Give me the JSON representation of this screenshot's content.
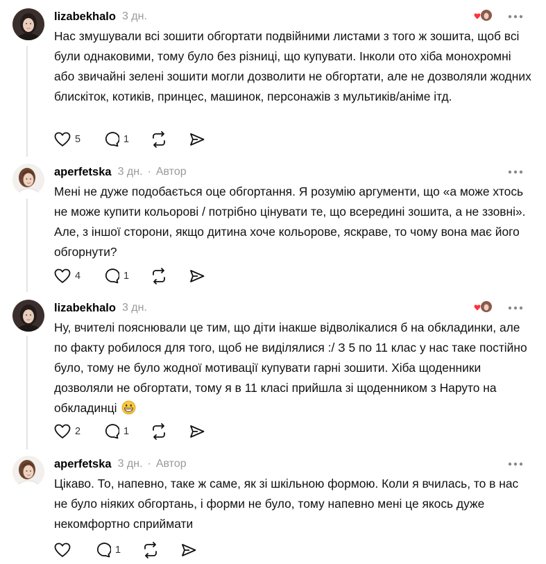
{
  "colors": {
    "text": "#111111",
    "meta": "#999999",
    "icon": "#111111",
    "thread_line": "#e3e3e3",
    "heart_red": "#ff3040"
  },
  "comments": [
    {
      "username": "lizabekhalo",
      "time": "3 дн.",
      "author_badge": "",
      "text": "Нас змушували всі зошити обгортати подвійними листами з того ж зошита, щоб всі були однаковими, тому було без різниці, що купувати. Інколи ото хіба монохромні або звичайні зелені зошити могли дозволити не обгортати, але не дозволяли жодних блискіток, котиків, принцес, машинок, персонажів з мультиків/аніме ітд.",
      "likes": "5",
      "replies": "1",
      "liked_by_author": true,
      "icons": [
        "heart-icon",
        "comment-icon",
        "repost-icon",
        "share-icon"
      ]
    },
    {
      "username": "aperfetska",
      "time": "3 дн.",
      "separator": "·",
      "author_badge": "Автор",
      "text": "Мені не дуже подобається оце обгортання. Я розумію аргументи, що «а може хтось не може купити кольорові / потрібно цінувати те, що всередині зошита, а не ззовні». Але, з іншої сторони, якщо дитина хоче кольорове, яскраве, то чому вона має його обгорнути?",
      "likes": "4",
      "replies": "1"
    },
    {
      "username": "lizabekhalo",
      "time": "3 дн.",
      "author_badge": "",
      "text": "Ну, вчителі пояснювали це тим, що діти інакше відволікалися б на обкладинки, але по факту робилося для того, щоб не виділялися :/ З 5 по 11 клас у нас таке постійно було, тому не було жодної мотивації купувати гарні зошити. Хіба щоденники дозволяли не обгортати, тому я в 11 класі прийшла зі щоденником з Наруто на обкладинці",
      "likes": "2",
      "replies": "1",
      "liked_by_author": true,
      "trailing_emoji": "grinning-face-emoji"
    },
    {
      "username": "aperfetska",
      "time": "3 дн.",
      "separator": "·",
      "author_badge": "Автор",
      "text": "Цікаво. То, напевно, таке ж саме, як зі шкільною формою. Коли я вчилась, то в нас не було ніяких обгортань, і форми не було, тому напевно мені це якось дуже некомфортно сприймати",
      "likes": "",
      "replies": "1"
    }
  ]
}
